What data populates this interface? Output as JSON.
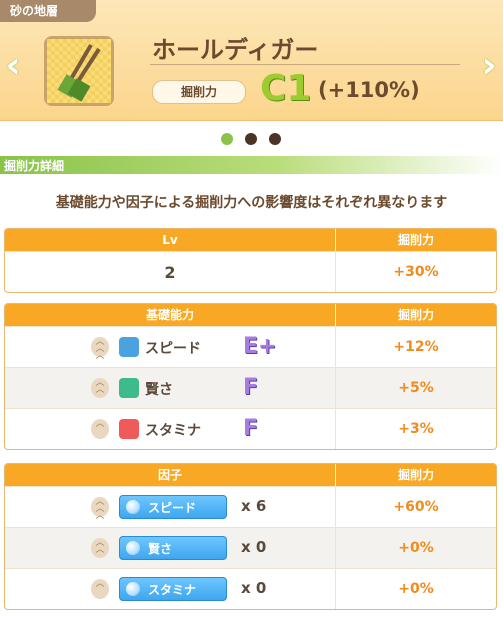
{
  "header": {
    "tab_label": "砂の地層",
    "item_name": "ホールディガー",
    "mining_label": "掘削力",
    "rank": "C1",
    "bonus": "(+110%)",
    "prev_icon": "chevron-left-icon",
    "next_icon": "chevron-right-icon"
  },
  "pager": {
    "count": 3,
    "active_index": 0,
    "active_color": "#8bc34a",
    "inactive_color": "#4a3426"
  },
  "section": {
    "label": "掘削力詳細",
    "description": "基礎能力や因子による掘削力への影響度はそれぞれ異なります"
  },
  "lv_table": {
    "col1": "Lv",
    "col2": "掘削力",
    "rows": [
      {
        "value": "2",
        "bonus": "+30%"
      }
    ]
  },
  "base_table": {
    "col1": "基礎能力",
    "col2": "掘削力",
    "rows": [
      {
        "name": "スピード",
        "grade": "E+",
        "bonus": "+12%",
        "icon": "shoe-icon",
        "icon_color": "#4aa3df"
      },
      {
        "name": "賢さ",
        "grade": "F",
        "bonus": "+5%",
        "icon": "graduation-cap-icon",
        "icon_color": "#3dbb8a"
      },
      {
        "name": "スタミナ",
        "grade": "F",
        "bonus": "+3%",
        "icon": "heart-icon",
        "icon_color": "#ef5b5b"
      }
    ]
  },
  "factor_table": {
    "col1": "因子",
    "col2": "掘削力",
    "rows": [
      {
        "name": "スピード",
        "count": "x 6",
        "bonus": "+60%"
      },
      {
        "name": "賢さ",
        "count": "x 0",
        "bonus": "+0%"
      },
      {
        "name": "スタミナ",
        "count": "x 0",
        "bonus": "+0%"
      }
    ]
  }
}
